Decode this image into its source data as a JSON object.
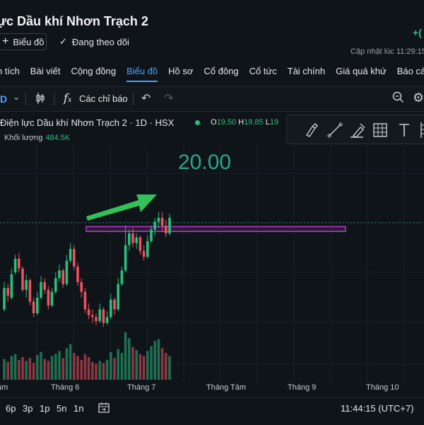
{
  "header": {
    "title": "ực Dầu khí Nhơn Trạch 2",
    "gain": "+(",
    "chart_button": "Biểu đồ",
    "follow_button": "Đang theo dõi",
    "updated": "Cập nhật lúc  11:29:15"
  },
  "tabs": [
    "n tích",
    "Bài viết",
    "Cộng đồng",
    "Biểu đồ",
    "Hồ sơ",
    "Cổ đông",
    "Cổ tức",
    "Tài chính",
    "Giá quá khứ",
    "Báo cáo"
  ],
  "active_tab": "Biểu đồ",
  "toolbar": {
    "interval": "D",
    "indicators": "Các chỉ báo"
  },
  "legend": {
    "symbol": "Điện lực Dầu khí Nhơn Trạch 2 · 1D · HSX",
    "o_label": "O",
    "o_value": "19.50",
    "h_label": "H",
    "h_value": "19.85",
    "l_label": "L",
    "l_value": "19",
    "volume_label": "Khối lượng",
    "volume_value": "484.5K"
  },
  "annotation": {
    "price": "20.00"
  },
  "x_ticks": [
    "ám",
    "Tháng 6",
    "Tháng 7",
    "Tháng Tám",
    "Tháng 9",
    "Tháng 10"
  ],
  "bottom": {
    "ranges": [
      "6p",
      "3p",
      "1p",
      "5n",
      "1n"
    ],
    "clock": "11:44:15 (UTC+7)"
  },
  "colors": {
    "up": "#27c07d",
    "down": "#f0505f",
    "accent": "#4aa3ff",
    "zone": "#b23cc8",
    "arrow": "#33c25a"
  },
  "chart_data": {
    "type": "candlestick",
    "candles": [
      {
        "o": 15.0,
        "c": 16.1,
        "h": 16.4,
        "l": 14.9
      },
      {
        "o": 16.1,
        "c": 15.7,
        "h": 16.3,
        "l": 15.4
      },
      {
        "o": 15.6,
        "c": 16.8,
        "h": 17.1,
        "l": 15.5
      },
      {
        "o": 16.9,
        "c": 17.6,
        "h": 17.8,
        "l": 16.8
      },
      {
        "o": 17.6,
        "c": 17.1,
        "h": 17.9,
        "l": 16.9
      },
      {
        "o": 17.1,
        "c": 16.0,
        "h": 17.2,
        "l": 15.9
      },
      {
        "o": 16.0,
        "c": 16.5,
        "h": 16.8,
        "l": 15.6
      },
      {
        "o": 16.5,
        "c": 15.4,
        "h": 16.6,
        "l": 15.2
      },
      {
        "o": 15.4,
        "c": 14.8,
        "h": 15.6,
        "l": 14.6
      },
      {
        "o": 14.8,
        "c": 15.6,
        "h": 15.9,
        "l": 14.7
      },
      {
        "o": 15.6,
        "c": 16.4,
        "h": 16.7,
        "l": 15.5
      },
      {
        "o": 16.4,
        "c": 16.0,
        "h": 16.6,
        "l": 15.8
      },
      {
        "o": 16.0,
        "c": 15.2,
        "h": 16.2,
        "l": 15.0
      },
      {
        "o": 15.2,
        "c": 15.9,
        "h": 16.1,
        "l": 15.1
      },
      {
        "o": 15.9,
        "c": 16.6,
        "h": 16.9,
        "l": 15.8
      },
      {
        "o": 16.6,
        "c": 17.0,
        "h": 17.3,
        "l": 16.4
      },
      {
        "o": 17.0,
        "c": 16.3,
        "h": 17.1,
        "l": 16.1
      },
      {
        "o": 16.3,
        "c": 17.5,
        "h": 17.8,
        "l": 16.2
      },
      {
        "o": 17.5,
        "c": 18.1,
        "h": 18.4,
        "l": 17.4
      },
      {
        "o": 18.1,
        "c": 17.2,
        "h": 18.3,
        "l": 17.0
      },
      {
        "o": 17.2,
        "c": 16.4,
        "h": 17.4,
        "l": 16.2
      },
      {
        "o": 16.4,
        "c": 15.9,
        "h": 16.6,
        "l": 15.6
      },
      {
        "o": 15.9,
        "c": 15.0,
        "h": 16.1,
        "l": 14.8
      },
      {
        "o": 15.0,
        "c": 14.7,
        "h": 15.3,
        "l": 14.5
      },
      {
        "o": 14.7,
        "c": 14.6,
        "h": 15.0,
        "l": 14.3
      },
      {
        "o": 14.6,
        "c": 14.4,
        "h": 14.8,
        "l": 14.2
      },
      {
        "o": 14.4,
        "c": 15.0,
        "h": 15.3,
        "l": 14.3
      },
      {
        "o": 15.0,
        "c": 14.3,
        "h": 15.1,
        "l": 14.1
      },
      {
        "o": 14.3,
        "c": 14.6,
        "h": 14.9,
        "l": 14.2
      },
      {
        "o": 14.6,
        "c": 15.5,
        "h": 15.8,
        "l": 14.5
      },
      {
        "o": 15.5,
        "c": 15.0,
        "h": 15.6,
        "l": 14.7
      },
      {
        "o": 15.0,
        "c": 16.3,
        "h": 16.6,
        "l": 14.9
      },
      {
        "o": 16.3,
        "c": 17.0,
        "h": 17.2,
        "l": 16.2
      },
      {
        "o": 17.0,
        "c": 18.3,
        "h": 19.3,
        "l": 16.9
      },
      {
        "o": 18.3,
        "c": 18.9,
        "h": 19.1,
        "l": 18.0
      },
      {
        "o": 18.9,
        "c": 18.4,
        "h": 19.2,
        "l": 18.2
      },
      {
        "o": 18.4,
        "c": 18.7,
        "h": 18.9,
        "l": 18.1
      },
      {
        "o": 18.7,
        "c": 18.0,
        "h": 18.8,
        "l": 17.8
      },
      {
        "o": 18.0,
        "c": 17.7,
        "h": 18.3,
        "l": 17.5
      },
      {
        "o": 17.7,
        "c": 18.5,
        "h": 18.8,
        "l": 17.6
      },
      {
        "o": 18.5,
        "c": 19.1,
        "h": 19.3,
        "l": 18.4
      },
      {
        "o": 19.1,
        "c": 19.5,
        "h": 19.7,
        "l": 18.8
      },
      {
        "o": 19.5,
        "c": 19.7,
        "h": 20.0,
        "l": 19.2
      },
      {
        "o": 19.7,
        "c": 19.3,
        "h": 20.0,
        "l": 19.0
      },
      {
        "o": 19.3,
        "c": 18.9,
        "h": 19.6,
        "l": 18.7
      },
      {
        "o": 18.9,
        "c": 19.7,
        "h": 19.9,
        "l": 18.8
      }
    ],
    "volumes": [
      2.1,
      1.8,
      2.4,
      2.6,
      2.0,
      2.3,
      1.9,
      2.2,
      1.7,
      2.5,
      2.8,
      2.1,
      1.9,
      2.4,
      2.6,
      2.9,
      2.2,
      3.2,
      3.6,
      2.7,
      2.4,
      2.0,
      2.6,
      2.3,
      1.8,
      1.6,
      1.9,
      1.7,
      2.0,
      2.8,
      2.2,
      3.1,
      2.7,
      4.8,
      4.2,
      3.3,
      3.0,
      2.6,
      2.4,
      2.9,
      3.4,
      3.9,
      4.1,
      3.2,
      2.7,
      2.4
    ],
    "zone": {
      "top": 19.25,
      "bottom": 19.0
    },
    "last_price": 19.45,
    "y_range": [
      14.0,
      20.9
    ]
  }
}
